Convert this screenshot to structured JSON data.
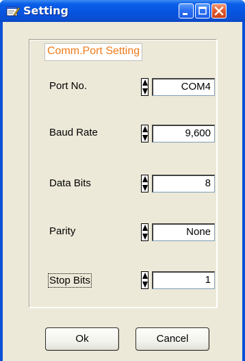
{
  "window": {
    "title": "Setting",
    "accent_color": "#0a50d8",
    "legend_color": "#f07a18"
  },
  "group": {
    "title": "Comm.Port Setting"
  },
  "fields": {
    "port": {
      "label": "Port No.",
      "value": "COM4"
    },
    "baud": {
      "label": "Baud Rate",
      "value": "9,600"
    },
    "databits": {
      "label": "Data Bits",
      "value": "8"
    },
    "parity": {
      "label": "Parity",
      "value": "None"
    },
    "stopbits": {
      "label": "Stop Bits",
      "value": "1"
    }
  },
  "buttons": {
    "ok_label": "Ok",
    "cancel_label": "Cancel"
  },
  "icons": {
    "app": "setting-app-icon",
    "minimize": "minimize-icon",
    "maximize": "maximize-icon",
    "close": "close-icon",
    "spin_up": "spin-up-icon",
    "spin_down": "spin-down-icon"
  }
}
